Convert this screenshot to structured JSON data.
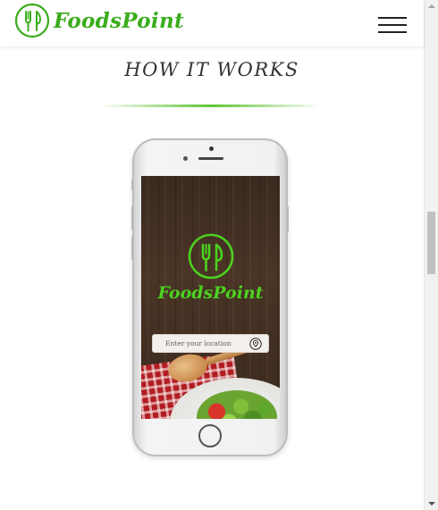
{
  "header": {
    "brand": "FoodsPoint",
    "logo_icon": "fork-knife-icon",
    "menu_icon": "hamburger-menu-icon"
  },
  "section": {
    "title": "HOW IT WORKS"
  },
  "phone_screen": {
    "brand": "FoodsPoint",
    "logo_icon": "fork-knife-icon",
    "location_placeholder": "Enter your location",
    "location_icon": "location-pin-icon"
  },
  "colors": {
    "brand_green": "#3aac1b",
    "screen_green": "#4cd11f",
    "title_text": "#333333",
    "underline_green": "#5ec433"
  }
}
